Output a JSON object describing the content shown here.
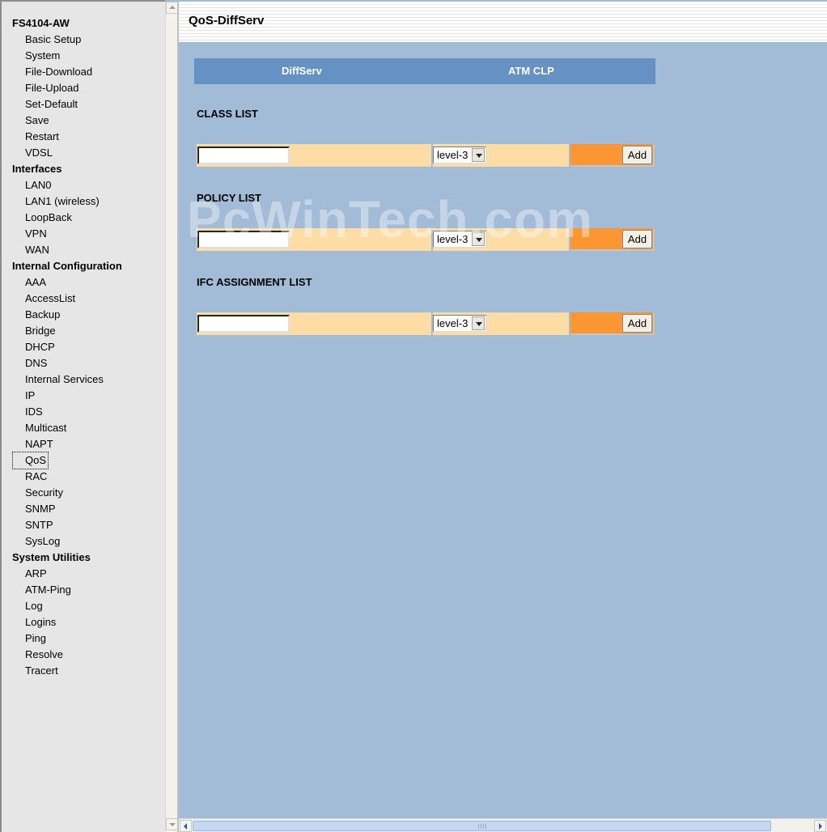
{
  "nav": {
    "device": "FS4104-AW",
    "groups": [
      {
        "heading": null,
        "items": [
          "Basic Setup",
          "System",
          "File-Download",
          "File-Upload",
          "Set-Default",
          "Save",
          "Restart",
          "VDSL"
        ]
      },
      {
        "heading": "Interfaces",
        "items": [
          "LAN0",
          "LAN1 (wireless)",
          "LoopBack",
          "VPN",
          "WAN"
        ]
      },
      {
        "heading": "Internal Configuration",
        "items": [
          "AAA",
          "AccessList",
          "Backup",
          "Bridge",
          "DHCP",
          "DNS",
          "Internal Services",
          "IP",
          "IDS",
          "Multicast",
          "NAPT",
          "QoS",
          "RAC",
          "Security",
          "SNMP",
          "SNTP",
          "SysLog"
        ]
      },
      {
        "heading": "System Utilities",
        "items": [
          "ARP",
          "ATM-Ping",
          "Log",
          "Logins",
          "Ping",
          "Resolve",
          "Tracert"
        ]
      }
    ],
    "active_item": "QoS"
  },
  "header": {
    "title": "QoS-DiffServ"
  },
  "tabs": [
    {
      "label": "DiffServ"
    },
    {
      "label": "ATM CLP"
    }
  ],
  "sections": [
    {
      "title": "CLASS LIST",
      "input_value": "",
      "select_value": "level-3",
      "button_label": "Add"
    },
    {
      "title": "POLICY LIST",
      "input_value": "",
      "select_value": "level-3",
      "button_label": "Add"
    },
    {
      "title": "IFC ASSIGNMENT LIST",
      "input_value": "",
      "select_value": "level-3",
      "button_label": "Add"
    }
  ],
  "watermark": "PcWinTech.com",
  "colors": {
    "page_bg": "#a2bbd6",
    "tab_bar": "#6692c3",
    "row_bg": "#fddca6",
    "action_cell": "#fc9632",
    "nav_bg": "#e6e6e6"
  }
}
